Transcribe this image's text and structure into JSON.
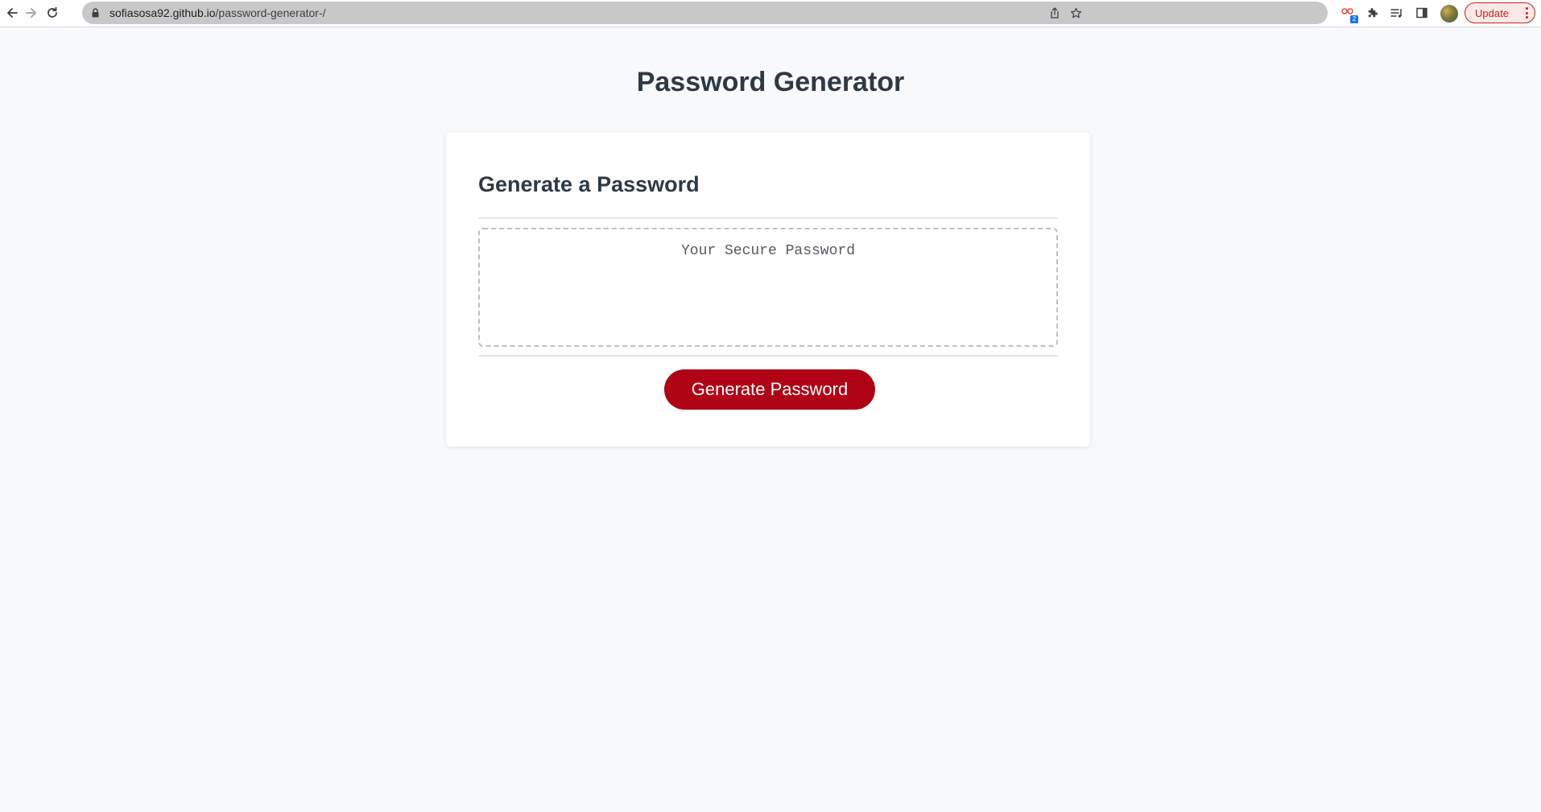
{
  "browser": {
    "url_host": "sofiasosa92.github.io",
    "url_path": "/password-generator-/",
    "extension_badge": "2",
    "update_label": "Update",
    "nav_icons": [
      "back-arrow-icon",
      "forward-arrow-icon",
      "reload-icon"
    ],
    "address_icons": [
      "lock-icon",
      "share-icon",
      "star-icon"
    ],
    "toolbar_icons": [
      "extension-icon",
      "puzzle-icon",
      "reading-list-icon",
      "side-panel-icon",
      "avatar",
      "kebab-icon"
    ]
  },
  "page": {
    "title": "Password Generator",
    "card": {
      "title": "Generate a Password",
      "password_placeholder": "Your Secure Password",
      "generate_button": "Generate Password"
    }
  },
  "colors": {
    "page_background": "#f8f9fc",
    "heading": "#2d3a45",
    "button_background": "#b00316",
    "button_text": "#ffffff",
    "update_accent": "#c5221f"
  }
}
